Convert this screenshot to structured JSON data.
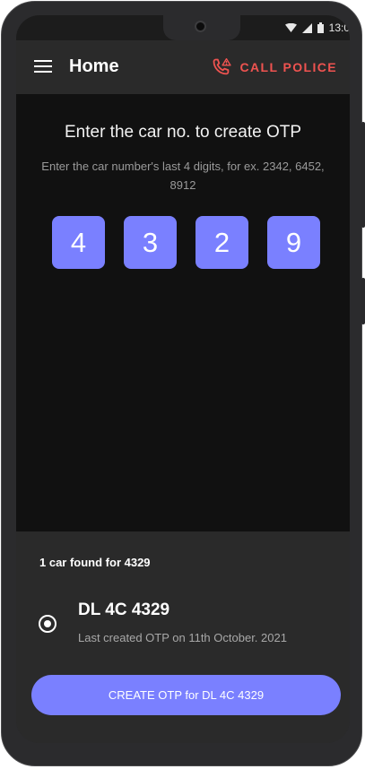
{
  "status_bar": {
    "time": "13:0",
    "icons": [
      "wifi-icon",
      "cell-signal-icon",
      "battery-icon"
    ]
  },
  "app_bar": {
    "title": "Home",
    "call_police_label": "CALL POLICE",
    "call_police_icon": "phone-alert-icon"
  },
  "main": {
    "heading": "Enter the car no. to create OTP",
    "subtext": "Enter the car number's last 4 digits, for ex. 2342, 6452, 8912",
    "digits": [
      "4",
      "3",
      "2",
      "9"
    ]
  },
  "results": {
    "found_text": "1 car found for 4329",
    "cars": [
      {
        "number": "DL 4C 4329",
        "subtitle": "Last created OTP on 11th October. 2021",
        "selected": true
      }
    ],
    "create_button_label": "CREATE OTP for DL 4C 4329"
  },
  "colors": {
    "accent": "#7a80ff",
    "danger": "#ef5350",
    "background": "#111111",
    "surface": "#2a2a2a"
  }
}
